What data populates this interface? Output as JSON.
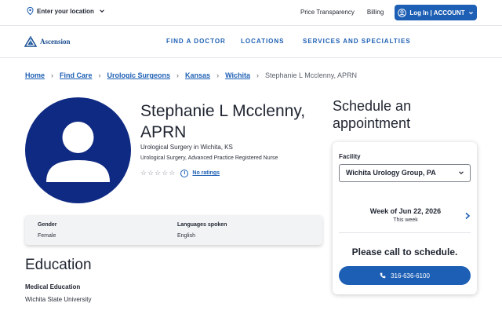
{
  "topbar": {
    "location_label": "Enter your location",
    "links": [
      "Price Transparency",
      "Billing"
    ],
    "login_label": "Log In | ACCOUNT"
  },
  "brand": {
    "name": "Ascension"
  },
  "nav": {
    "items": [
      "FIND A DOCTOR",
      "LOCATIONS",
      "SERVICES AND SPECIALTIES"
    ]
  },
  "breadcrumb": {
    "items": [
      "Home",
      "Find Care",
      "Urologic Surgeons",
      "Kansas",
      "Wichita"
    ],
    "current": "Stephanie L Mcclenny, APRN"
  },
  "provider": {
    "name_line1": "Stephanie L Mcclenny,",
    "name_line2": "APRN",
    "specialty_location": "Urological Surgery in Wichita, KS",
    "credentials": "Urological Surgery, Advanced Practice Registered Nurse",
    "stars_filled": 0,
    "stars_total": 5,
    "ratings_link": "No ratings"
  },
  "details": {
    "gender_label": "Gender",
    "gender_value": "Female",
    "languages_label": "Languages spoken",
    "languages_value": "English"
  },
  "education": {
    "title": "Education",
    "medical_label": "Medical Education",
    "medical_value": "Wichita State University"
  },
  "schedule": {
    "title_line1": "Schedule an",
    "title_line2": "appointment",
    "facility_label": "Facility",
    "facility_value": "Wichita Urology Group, PA",
    "week_label": "Week of Jun 22, 2026",
    "week_sub": "This week",
    "call_message": "Please call to schedule.",
    "phone": "316-636-6100"
  },
  "colors": {
    "accent": "#1d5fb4",
    "avatar_bg": "#0f2a82",
    "card_bg": "#f2f3f5"
  }
}
